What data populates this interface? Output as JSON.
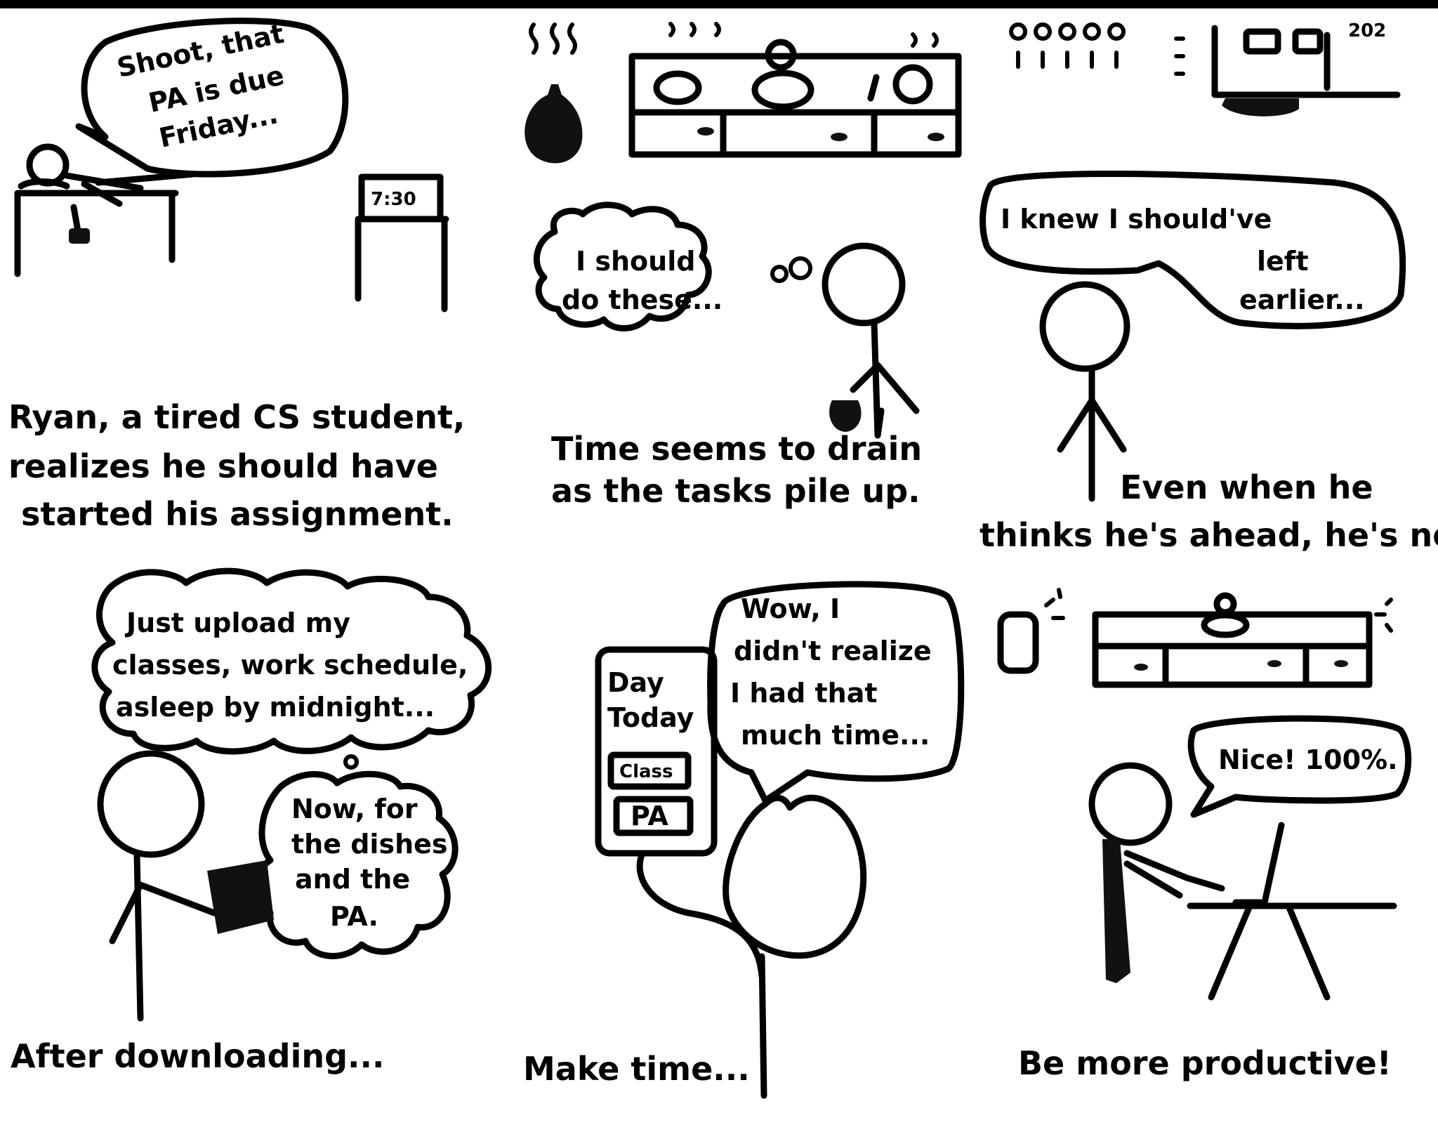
{
  "panels": [
    {
      "bubble_lines": [
        "Shoot, that",
        "PA is due",
        "Friday..."
      ],
      "clock": "7:30",
      "caption_lines": [
        "Ryan, a tired CS student,",
        "realizes he should have",
        "started his assignment."
      ]
    },
    {
      "bubble_lines": [
        "I should",
        "do these..."
      ],
      "caption_lines": [
        "Time seems to drain",
        "as the tasks pile up."
      ]
    },
    {
      "counter": "202",
      "bubble_lines": [
        "I knew I should've",
        "left",
        "earlier..."
      ],
      "caption_lines": [
        "Even when he",
        "thinks he's ahead, he's not."
      ]
    },
    {
      "bubble1_lines": [
        "Just upload my",
        "classes, work schedule,",
        "asleep by midnight..."
      ],
      "bubble2_lines": [
        "Now, for",
        "the dishes",
        "and the",
        "PA."
      ],
      "caption_lines": [
        "After downloading..."
      ]
    },
    {
      "phone_lines": [
        "Day",
        "Today"
      ],
      "phone_items": [
        "Class",
        "PA"
      ],
      "bubble_lines": [
        "Wow, I",
        "didn't realize",
        "I had that",
        "much time..."
      ],
      "caption_lines": [
        "Make time..."
      ]
    },
    {
      "bubble_lines": [
        "Nice! 100%."
      ],
      "caption_lines": [
        "Be more productive!"
      ]
    }
  ]
}
